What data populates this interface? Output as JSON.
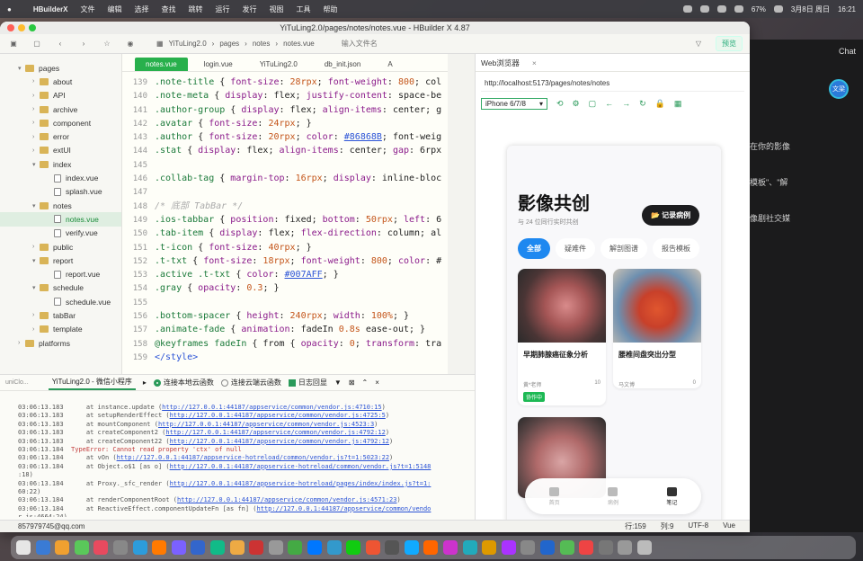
{
  "menubar": {
    "app": "HBuilderX",
    "items": [
      "文件",
      "编辑",
      "选择",
      "查找",
      "跳转",
      "运行",
      "发行",
      "视图",
      "工具",
      "帮助"
    ],
    "battery": "67%",
    "date": "3月8日 周日",
    "time": "16:21"
  },
  "window": {
    "title": "YiTuLing2.0/pages/notes/notes.vue - HBuilder X 4.87"
  },
  "toolbar": {
    "crumbs": [
      "YiTuLing2.0",
      "pages",
      "notes",
      "notes.vue"
    ],
    "file_placeholder": "输入文件名",
    "preview": "预览"
  },
  "sidebar": {
    "items": [
      {
        "label": "pages",
        "level": 0,
        "folder": true,
        "open": true
      },
      {
        "label": "about",
        "level": 1,
        "folder": true
      },
      {
        "label": "API",
        "level": 1,
        "folder": true
      },
      {
        "label": "archive",
        "level": 1,
        "folder": true
      },
      {
        "label": "component",
        "level": 1,
        "folder": true
      },
      {
        "label": "error",
        "level": 1,
        "folder": true
      },
      {
        "label": "extUI",
        "level": 1,
        "folder": true
      },
      {
        "label": "index",
        "level": 1,
        "folder": true,
        "open": true
      },
      {
        "label": "index.vue",
        "level": 2,
        "folder": false
      },
      {
        "label": "splash.vue",
        "level": 2,
        "folder": false
      },
      {
        "label": "notes",
        "level": 1,
        "folder": true,
        "open": true
      },
      {
        "label": "notes.vue",
        "level": 2,
        "folder": false,
        "selected": true
      },
      {
        "label": "verify.vue",
        "level": 2,
        "folder": false
      },
      {
        "label": "public",
        "level": 1,
        "folder": true
      },
      {
        "label": "report",
        "level": 1,
        "folder": true,
        "open": true
      },
      {
        "label": "report.vue",
        "level": 2,
        "folder": false
      },
      {
        "label": "schedule",
        "level": 1,
        "folder": true,
        "open": true
      },
      {
        "label": "schedule.vue",
        "level": 2,
        "folder": false
      },
      {
        "label": "tabBar",
        "level": 1,
        "folder": true
      },
      {
        "label": "template",
        "level": 1,
        "folder": true
      },
      {
        "label": "platforms",
        "level": 0,
        "folder": true
      }
    ]
  },
  "editor": {
    "tabs": [
      "notes.vue",
      "login.vue",
      "YiTuLing2.0",
      "db_init.json",
      "A"
    ],
    "lines": [
      {
        "n": "139",
        "t": ".note-title { font-size: 28rpx; font-weight: 800; col"
      },
      {
        "n": "140",
        "t": ".note-meta { display: flex; justify-content: space-be"
      },
      {
        "n": "141",
        "t": ".author-group { display: flex; align-items: center; g"
      },
      {
        "n": "142",
        "t": ".avatar { font-size: 24rpx; }"
      },
      {
        "n": "143",
        "t": ".author { font-size: 20rpx; color: #86868B; font-weig"
      },
      {
        "n": "144",
        "t": ".stat { display: flex; align-items: center; gap: 6rpx"
      },
      {
        "n": "145",
        "t": ""
      },
      {
        "n": "146",
        "t": ".collab-tag { margin-top: 16rpx; display: inline-bloc"
      },
      {
        "n": "147",
        "t": ""
      },
      {
        "n": "148",
        "t": "/* 底部 TabBar */"
      },
      {
        "n": "149",
        "t": ".ios-tabbar { position: fixed; bottom: 50rpx; left: 6"
      },
      {
        "n": "150",
        "t": ".tab-item { display: flex; flex-direction: column; al"
      },
      {
        "n": "151",
        "t": ".t-icon { font-size: 40rpx; }"
      },
      {
        "n": "152",
        "t": ".t-txt { font-size: 18rpx; font-weight: 800; color: #"
      },
      {
        "n": "153",
        "t": ".active .t-txt { color: #007AFF; }"
      },
      {
        "n": "154",
        "t": ".gray { opacity: 0.3; }"
      },
      {
        "n": "155",
        "t": ""
      },
      {
        "n": "156",
        "t": ".bottom-spacer { height: 240rpx; width: 100%; }"
      },
      {
        "n": "157",
        "t": ".animate-fade { animation: fadeIn 0.8s ease-out; }"
      },
      {
        "n": "158",
        "t": "@keyframes fadeIn { from { opacity: 0; transform: tra"
      },
      {
        "n": "159",
        "t": "</style>"
      }
    ]
  },
  "browser": {
    "tab": "Web浏览器",
    "url": "http://localhost:5173/pages/notes/notes",
    "device": "iPhone 6/7/8"
  },
  "app": {
    "title": "影像共创",
    "subtitle": "与 24 位同行实时共创",
    "case_button": "📂 记录病例",
    "chips": [
      "全部",
      "疑难件",
      "解剖图谱",
      "报告模板"
    ],
    "cards": [
      {
        "title": "早期肺腺癌征象分析",
        "author": "黄*老师",
        "stat": "10",
        "badge": "协作中"
      },
      {
        "title": "腰椎间盘突出分型",
        "author": "马文博",
        "stat": "0"
      }
    ],
    "tabbar": [
      {
        "label": "首页"
      },
      {
        "label": "病例"
      },
      {
        "label": "笔记",
        "active": true
      }
    ]
  },
  "console": {
    "title": "YiTuLing2.0 - 微信小程序",
    "opt1": "连接本地云函数",
    "opt2": "连接云端云函数",
    "opt3": "日志回显",
    "left_label": "uniClo..."
  },
  "logs": [
    {
      "ts": "03:06:13.183",
      "txt": "    at instance.update (",
      "url": "http://127.0.0.1:44187/appservice/common/vendor.js:4710:15",
      "tail": ")",
      "err": false
    },
    {
      "ts": "03:06:13.183",
      "txt": "    at setupRenderEffect (",
      "url": "http://127.0.0.1:44187/appservice/common/vendor.js:4725:5",
      "tail": ")",
      "err": false
    },
    {
      "ts": "03:06:13.183",
      "txt": "    at mountComponent (",
      "url": "http://127.0.0.1:44187/appservice/common/vendor.js:4523:3",
      "tail": ")",
      "err": false
    },
    {
      "ts": "03:06:13.183",
      "txt": "    at createComponent2 (",
      "url": "http://127.0.0.1:44187/appservice/common/vendor.js:4792:12",
      "tail": ")",
      "err": false
    },
    {
      "ts": "03:06:13.183",
      "txt": "    at createComponent22 (",
      "url": "http://127.0.0.1:44187/appservice/common/vendor.js:4792:12",
      "tail": ")",
      "err": false
    },
    {
      "ts": "03:06:13.184",
      "txt": "TypeError: Cannot read property 'ctx' of null",
      "url": "",
      "tail": "",
      "err": true
    },
    {
      "ts": "03:06:13.184",
      "txt": "    at vOn (",
      "url": "http://127.0.0.1:44187/appservice-hotreload/common/vendor.js?t=1:5023:22",
      "tail": ")",
      "err": false
    },
    {
      "ts": "03:06:13.184",
      "txt": "    at Object.o$1 [as o] (",
      "url": "http://127.0.0.1:44187/appservice-hotreload/common/vendor.js?t=1:5148",
      "tail": "",
      "err": false
    },
    {
      "ts": "",
      "txt": ":18)",
      "url": "",
      "tail": "",
      "err": false
    },
    {
      "ts": "03:06:13.184",
      "txt": "    at Proxy._sfc_render (",
      "url": "http://127.0.0.1:44187/appservice-hotreload/pages/index/index.js?t=1:",
      "tail": "",
      "err": false
    },
    {
      "ts": "",
      "txt": "60:22)",
      "url": "",
      "tail": "",
      "err": false
    },
    {
      "ts": "03:06:13.184",
      "txt": "    at renderComponentRoot (",
      "url": "http://127.0.0.1:44187/appservice/common/vendor.js:4571:23",
      "tail": ")",
      "err": false
    },
    {
      "ts": "03:06:13.184",
      "txt": "    at ReactiveEffect.componentUpdateFn [as fn] (",
      "url": "http://127.0.0.1:44187/appservice/common/vendo",
      "tail": "",
      "err": false
    },
    {
      "ts": "",
      "txt": "r.js:4664:24)",
      "url": "",
      "tail": "",
      "err": false
    }
  ],
  "statusbar": {
    "email": "857979745@qq.com",
    "row": "行:159",
    "col": "列:9",
    "encoding": "UTF-8",
    "lang": "Vue"
  },
  "side_app": {
    "chat": "Chat",
    "avatar": "文梁",
    "lines": [
      "在你的影像",
      "模板\"、\"解",
      "像剧社交媒"
    ]
  }
}
